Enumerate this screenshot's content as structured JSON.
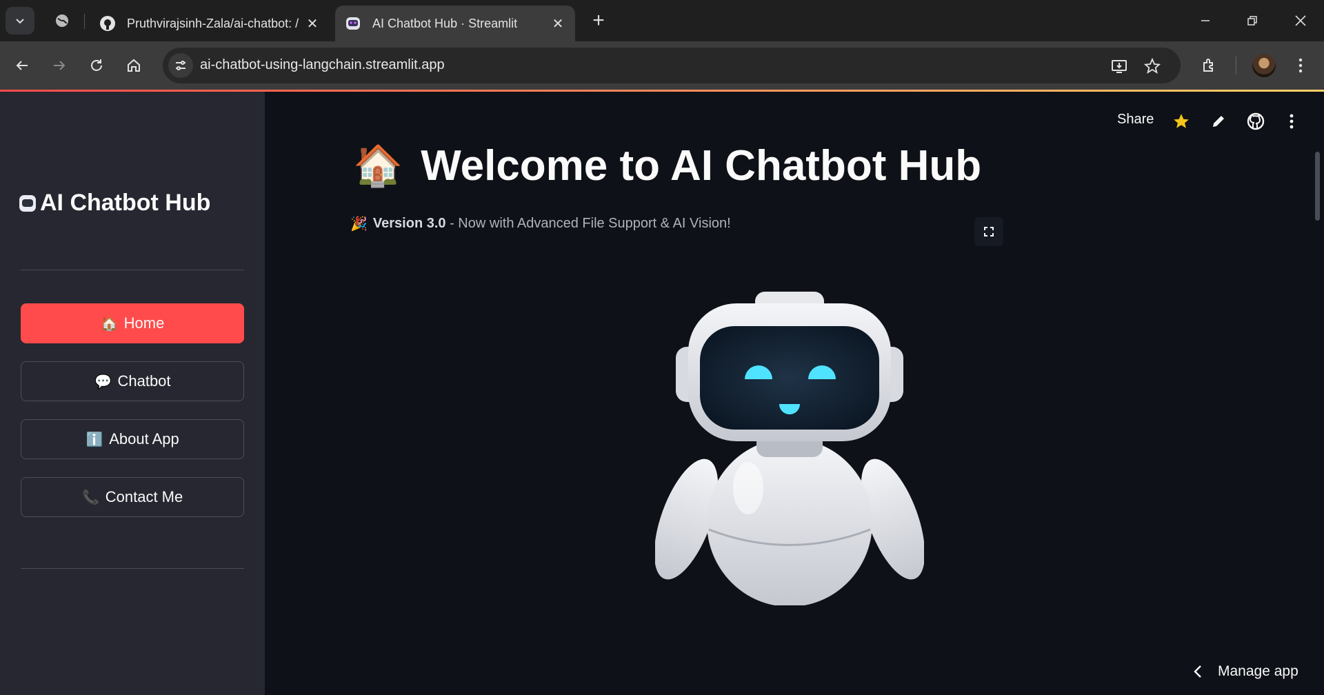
{
  "browser": {
    "tabs": [
      {
        "title": "Pruthvirajsinh-Zala/ai-chatbot: /",
        "favicon": "github-icon"
      },
      {
        "title": "AI Chatbot Hub · Streamlit",
        "favicon": "streamlit-robot-icon"
      }
    ],
    "url": "ai-chatbot-using-langchain.streamlit.app",
    "window_controls": [
      "minimize",
      "restore",
      "close"
    ]
  },
  "header": {
    "share_label": "Share",
    "icons": [
      "star-icon",
      "edit-icon",
      "github-icon",
      "more-icon"
    ]
  },
  "sidebar": {
    "title": "AI Chatbot Hub",
    "nav": [
      {
        "emoji": "🏠",
        "label": "Home",
        "active": true
      },
      {
        "emoji": "💬",
        "label": "Chatbot",
        "active": false
      },
      {
        "emoji": "ℹ️",
        "label": "About App",
        "active": false
      },
      {
        "emoji": "📞",
        "label": "Contact Me",
        "active": false
      }
    ]
  },
  "main": {
    "title_emoji": "🏠",
    "title": "Welcome to AI Chatbot Hub",
    "subtitle_emoji": "🎉",
    "subtitle_bold": "Version 3.0",
    "subtitle_rest": " - Now with Advanced File Support & AI Vision!"
  },
  "footer": {
    "manage_app_label": "Manage app"
  },
  "colors": {
    "accent": "#ff4b4b",
    "sidebar_bg": "#262730",
    "main_bg": "#0e1117"
  }
}
